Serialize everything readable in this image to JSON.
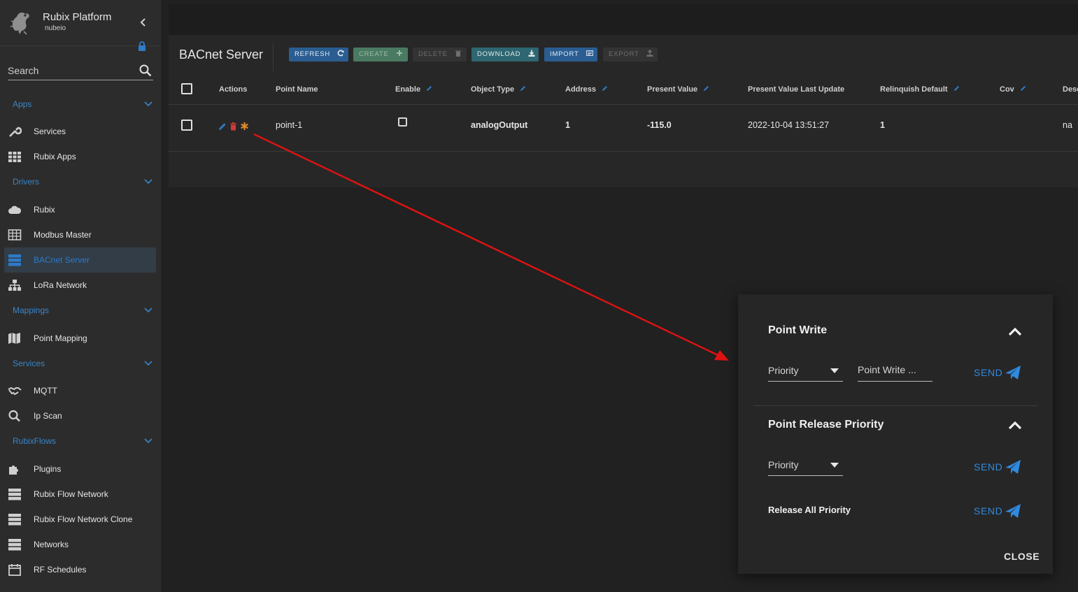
{
  "sidebar": {
    "brand": {
      "title": "Rubix Platform",
      "subtitle": "nubeio"
    },
    "search": {
      "placeholder": "Search"
    },
    "sections": {
      "apps": "Apps",
      "drivers": "Drivers",
      "mappings": "Mappings",
      "services": "Services",
      "rubixflows": "RubixFlows"
    },
    "items": {
      "services": "Services",
      "rubix_apps": "Rubix Apps",
      "rubix": "Rubix",
      "modbus_master": "Modbus Master",
      "bacnet_server": "BACnet Server",
      "lora_network": "LoRa Network",
      "point_mapping": "Point Mapping",
      "mqtt": "MQTT",
      "ip_scan": "Ip Scan",
      "plugins": "Plugins",
      "rubix_flow_network": "Rubix Flow Network",
      "rubix_flow_network_clone": "Rubix Flow Network Clone",
      "networks": "Networks",
      "rf_schedules": "RF Schedules"
    },
    "active_item": "BACnet Server"
  },
  "main": {
    "title": "BACnet Server",
    "toolbar": {
      "refresh": "REFRESH",
      "create": "CREATE",
      "delete": "DELETE",
      "download": "DOWNLOAD",
      "import": "IMPORT",
      "export": "EXPORT"
    },
    "table": {
      "columns": {
        "actions": "Actions",
        "point_name": "Point Name",
        "enable": "Enable",
        "object_type": "Object Type",
        "address": "Address",
        "present_value": "Present Value",
        "present_value_last_update": "Present Value Last Update",
        "relinquish_default": "Relinquish Default",
        "cov": "Cov",
        "description": "Desc"
      },
      "rows": [
        {
          "point_name": "point-1",
          "enable": false,
          "object_type": "analogOutput",
          "address": "1",
          "present_value": "-115.0",
          "present_value_last_update": "2022-10-04 13:51:27",
          "relinquish_default": "1",
          "cov": "",
          "description": "na"
        }
      ]
    }
  },
  "dialog": {
    "point_write": {
      "title": "Point Write",
      "priority_label": "Priority",
      "value_placeholder": "Point Write ...",
      "send": "SEND"
    },
    "point_release_priority": {
      "title": "Point Release Priority",
      "priority_label": "Priority",
      "send": "SEND",
      "release_all_label": "Release All Priority",
      "release_all_send": "SEND"
    },
    "close": "CLOSE"
  },
  "colors": {
    "background": "#212121",
    "sidebar": "#2c2c2c",
    "accent_blue": "#2f8ae0",
    "section_blue": "#3a85c8",
    "annotation_arrow": "#e01212"
  }
}
